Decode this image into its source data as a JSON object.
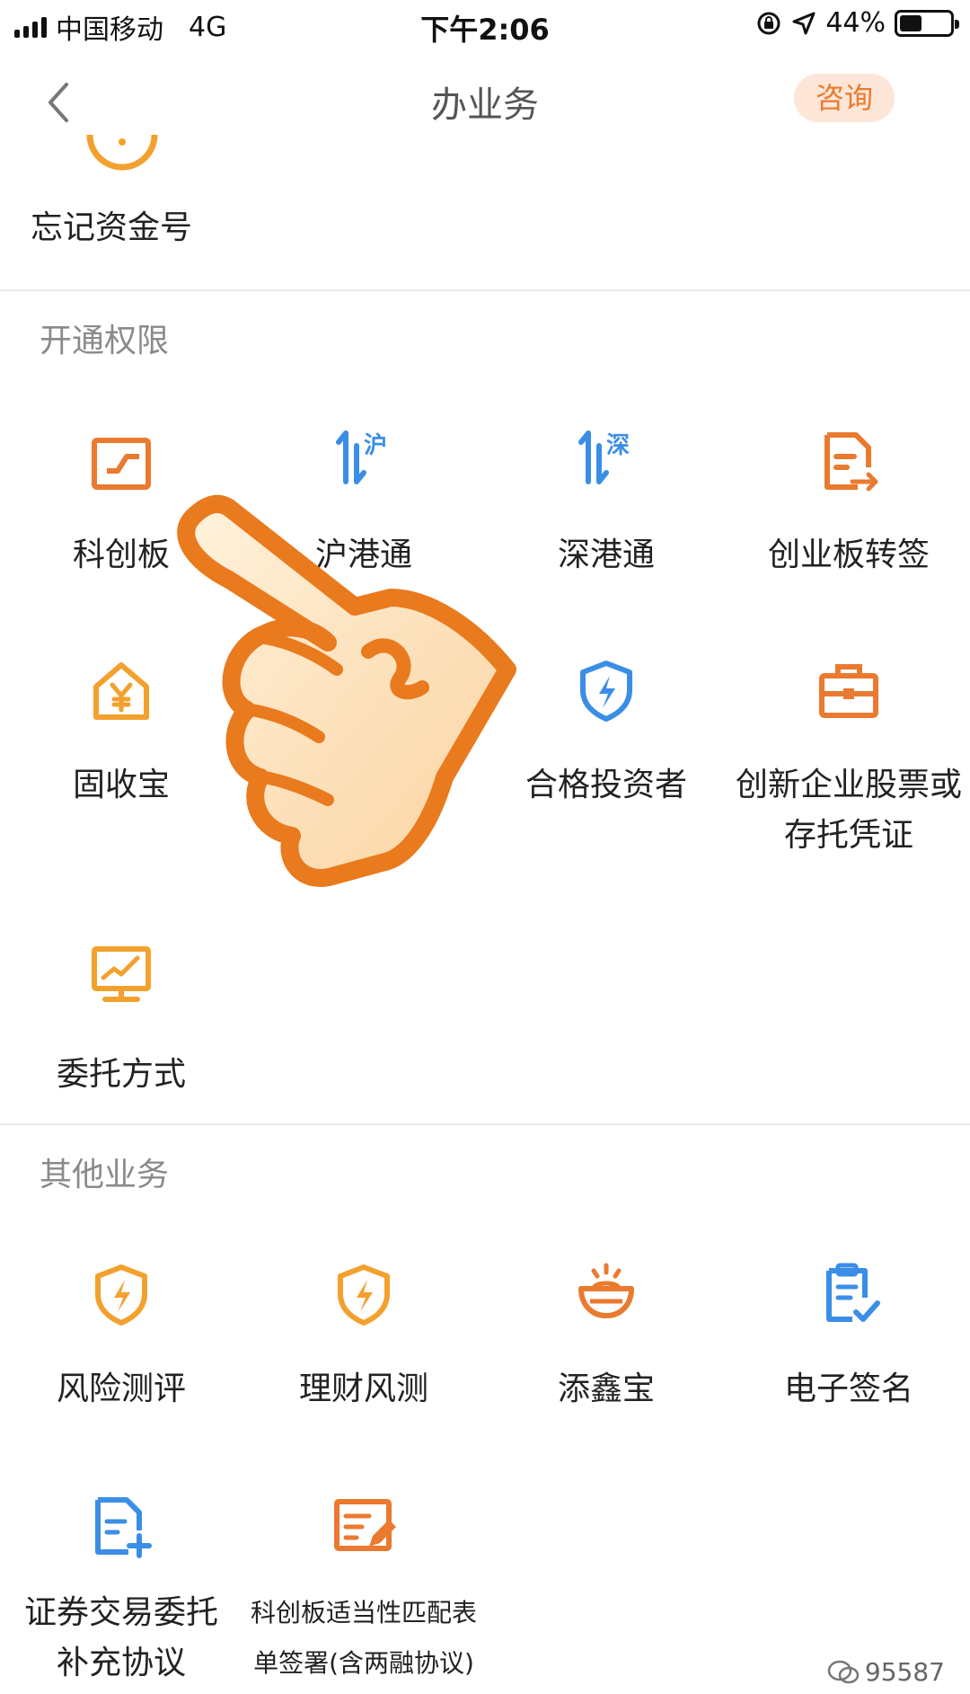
{
  "status_bar": {
    "carrier": "中国移动",
    "network": "4G",
    "time": "下午2:06",
    "battery": "44%",
    "battery_level": 0.44
  },
  "nav": {
    "title": "办业务",
    "consult": "咨询",
    "icons": {
      "back": "chevron-left-icon"
    }
  },
  "top_partial": {
    "label": "忘记资金号"
  },
  "sections": [
    {
      "title": "开通权限",
      "items": [
        {
          "label": "科创板",
          "icon": "star-market-icon",
          "color": "#ea7a2f"
        },
        {
          "label": "沪港通",
          "icon": "shanghai-hk-connect-icon",
          "color": "#3b8ee6"
        },
        {
          "label": "深港通",
          "icon": "shenzhen-hk-connect-icon",
          "color": "#3b8ee6"
        },
        {
          "label": "创业板转签",
          "icon": "document-transfer-icon",
          "color": "#ea7a2f"
        },
        {
          "label": "固收宝",
          "icon": "house-yuan-icon",
          "color": "#f3a12e"
        },
        {
          "label": "合格投资者",
          "icon": "shield-bolt-icon",
          "color": "#3b8ee6"
        },
        {
          "label_line1": "创新企业股票或",
          "label_line2": "存托凭证",
          "icon": "briefcase-icon",
          "color": "#ea7a2f"
        },
        {
          "label": "委托方式",
          "icon": "monitor-chart-icon",
          "color": "#f3a12e"
        }
      ]
    },
    {
      "title": "其他业务",
      "items": [
        {
          "label": "风险测评",
          "icon": "shield-bolt-icon",
          "color": "#f3a12e"
        },
        {
          "label": "理财风测",
          "icon": "shield-bolt-icon",
          "color": "#f3a12e"
        },
        {
          "label": "添鑫宝",
          "icon": "gold-ingot-icon",
          "color": "#ea7a2f"
        },
        {
          "label": "电子签名",
          "icon": "clipboard-check-icon",
          "color": "#3b8ee6"
        },
        {
          "label_line1": "证券交易委托",
          "label_line2": "补充协议",
          "icon": "document-plus-icon",
          "color": "#3b8ee6"
        },
        {
          "label_line1": "科创板适当性匹配表",
          "label_line2": "单签署(含两融协议)",
          "icon": "document-edit-icon",
          "color": "#ea7a2f"
        }
      ]
    }
  ],
  "overlay": {
    "icon": "pointing-hand-icon"
  },
  "watermark": {
    "text": "95587",
    "icon": "wechat-icon"
  }
}
